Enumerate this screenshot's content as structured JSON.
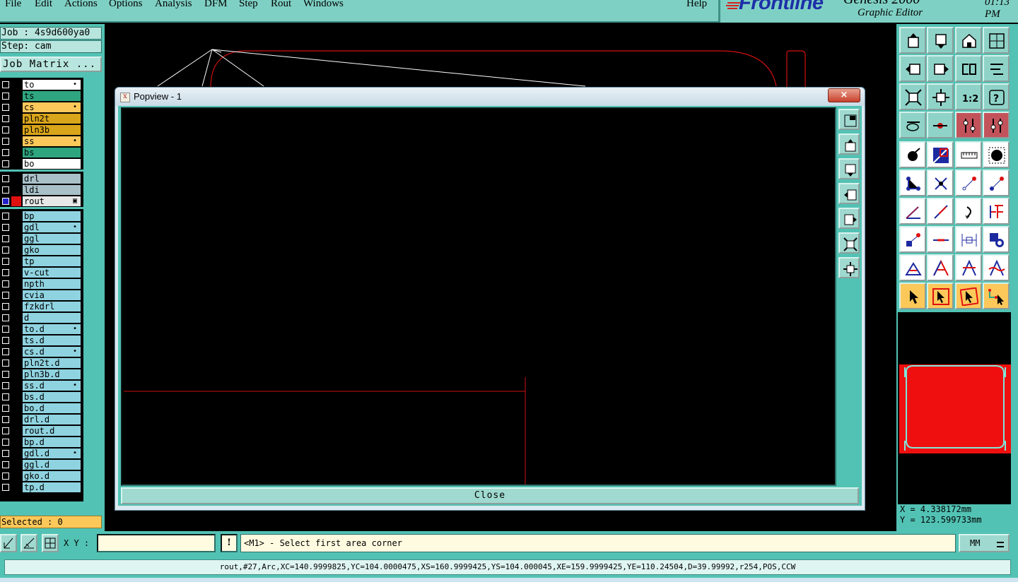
{
  "menu": {
    "items": [
      "File",
      "Edit",
      "Actions",
      "Options",
      "Analysis",
      "DFM",
      "Step",
      "Rout",
      "Windows"
    ],
    "help": "Help"
  },
  "brand": {
    "logo": "Frontline",
    "product": "Genesis 2000",
    "subtitle": "Graphic Editor",
    "clock": "01:13 PM"
  },
  "left": {
    "job": "Job : 4s9d600ya0",
    "step": "Step: cam",
    "job_matrix": "Job Matrix ...",
    "layers": [
      {
        "name": "to",
        "color": "#ffffff",
        "flag": "•"
      },
      {
        "name": "ts",
        "color": "#2fa57f",
        "flag": ""
      },
      {
        "name": "cs",
        "color": "#fcc85a",
        "flag": "•"
      },
      {
        "name": "pln2t",
        "color": "#d9a51a",
        "flag": ""
      },
      {
        "name": "pln3b",
        "color": "#d9a51a",
        "flag": ""
      },
      {
        "name": "ss",
        "color": "#fcc85a",
        "flag": "•"
      },
      {
        "name": "bs",
        "color": "#2fa57f",
        "flag": ""
      },
      {
        "name": "bo",
        "color": "#ffffff",
        "flag": ""
      },
      {
        "name": "drl",
        "color": "#a9c0c8",
        "flag": ""
      },
      {
        "name": "ldi",
        "color": "#a9c0c8",
        "flag": ""
      },
      {
        "name": "rout",
        "color": "#e8e8e8",
        "flag": "▣",
        "active": true
      },
      {
        "name": "bp",
        "color": "#8fd3e0",
        "flag": ""
      },
      {
        "name": "gdl",
        "color": "#8fd3e0",
        "flag": "•"
      },
      {
        "name": "ggl",
        "color": "#8fd3e0",
        "flag": ""
      },
      {
        "name": "gko",
        "color": "#8fd3e0",
        "flag": ""
      },
      {
        "name": "tp",
        "color": "#8fd3e0",
        "flag": ""
      },
      {
        "name": "v-cut",
        "color": "#8fd3e0",
        "flag": ""
      },
      {
        "name": "npth",
        "color": "#8fd3e0",
        "flag": ""
      },
      {
        "name": "cvia",
        "color": "#8fd3e0",
        "flag": ""
      },
      {
        "name": "fzkdrl",
        "color": "#8fd3e0",
        "flag": ""
      },
      {
        "name": "d",
        "color": "#8fd3e0",
        "flag": ""
      },
      {
        "name": "to.d",
        "color": "#8fd3e0",
        "flag": "•"
      },
      {
        "name": "ts.d",
        "color": "#8fd3e0",
        "flag": ""
      },
      {
        "name": "cs.d",
        "color": "#8fd3e0",
        "flag": "•"
      },
      {
        "name": "pln2t.d",
        "color": "#8fd3e0",
        "flag": ""
      },
      {
        "name": "pln3b.d",
        "color": "#8fd3e0",
        "flag": ""
      },
      {
        "name": "ss.d",
        "color": "#8fd3e0",
        "flag": "•"
      },
      {
        "name": "bs.d",
        "color": "#8fd3e0",
        "flag": ""
      },
      {
        "name": "bo.d",
        "color": "#8fd3e0",
        "flag": ""
      },
      {
        "name": "drl.d",
        "color": "#8fd3e0",
        "flag": ""
      },
      {
        "name": "rout.d",
        "color": "#8fd3e0",
        "flag": ""
      },
      {
        "name": "bp.d",
        "color": "#8fd3e0",
        "flag": ""
      },
      {
        "name": "gdl.d",
        "color": "#8fd3e0",
        "flag": "•"
      },
      {
        "name": "ggl.d",
        "color": "#8fd3e0",
        "flag": ""
      },
      {
        "name": "gko.d",
        "color": "#8fd3e0",
        "flag": ""
      },
      {
        "name": "tp.d",
        "color": "#8fd3e0",
        "flag": ""
      }
    ],
    "selected": "Selected : 0"
  },
  "popview": {
    "title": "Popview - 1",
    "close_x": "×",
    "close_button": "Close",
    "side_icons": [
      "zoom-window-icon",
      "move-up-icon",
      "move-down-icon",
      "move-left-icon",
      "move-right-icon",
      "zoom-out-icon",
      "zoom-in-icon"
    ]
  },
  "right": {
    "tool_icons": [
      "move-up-icon",
      "move-down-icon",
      "home-icon",
      "grid-icon",
      "move-left-icon",
      "move-right-icon",
      "rotate-icon",
      "snap-icon",
      "zoom-fit-icon",
      "zoom-center-icon",
      "scale-1-2-icon",
      "help-icon",
      "measure-tool-icon",
      "pad-tool-icon",
      "layer-pair-icon",
      "layer-pair-alt-icon",
      "pad-select-icon",
      "line-select-icon",
      "ruler-icon",
      "round-pad-icon",
      "net-icon",
      "cross-icon",
      "arrow-node-icon",
      "node-icon",
      "angle-icon",
      "diagonal-icon",
      "curve-icon",
      "split-icon",
      "pad-corner-icon",
      "line-h-icon",
      "dimension-icon",
      "clone-icon",
      "triangle-icon",
      "text-a-icon",
      "text-a-bar-icon",
      "text-a-wave-icon",
      "select-arrow-icon",
      "select-arrow-box-icon",
      "select-arrow-alt-icon",
      "select-route-icon"
    ],
    "coord_x": "X = 4.338172mm",
    "coord_y": "Y = 123.599733mm"
  },
  "cmd": {
    "xy_label": "X Y :",
    "xy_value": "",
    "bang": "!",
    "prompt": "<M1> - Select first area corner",
    "units": "MM"
  },
  "status": {
    "text": "rout,#27,Arc,XC=140.9999825,YC=104.0000475,XS=160.9999425,YS=104.000045,XE=159.9999425,YE=110.24504,D=39.99992,r254,POS,CCW"
  }
}
